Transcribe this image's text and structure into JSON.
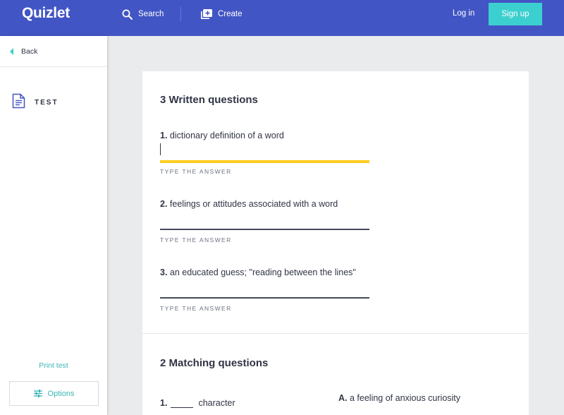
{
  "header": {
    "logo": "Quizlet",
    "search_label": "Search",
    "create_label": "Create",
    "login_label": "Log in",
    "signup_label": "Sign up"
  },
  "sidebar": {
    "back_label": "Back",
    "mode_label": "TEST",
    "print_label": "Print test",
    "options_label": "Options"
  },
  "written": {
    "title": "3 Written questions",
    "hint": "TYPE THE ANSWER",
    "questions": [
      {
        "num": "1.",
        "text": "dictionary definition of a word"
      },
      {
        "num": "2.",
        "text": "feelings or attitudes associated with a word"
      },
      {
        "num": "3.",
        "text": "an educated guess; \"reading between the lines\""
      }
    ]
  },
  "matching": {
    "title": "2 Matching questions",
    "questions": [
      {
        "num": "1.",
        "text": "character"
      }
    ],
    "answers": [
      {
        "letter": "A.",
        "text": "a feeling of anxious curiosity"
      }
    ]
  },
  "colors": {
    "header_bg": "#4255c4",
    "signup_bg": "#3ccfcf",
    "active_underline": "#ffcd1f",
    "accent_text": "#3ab4b4"
  }
}
